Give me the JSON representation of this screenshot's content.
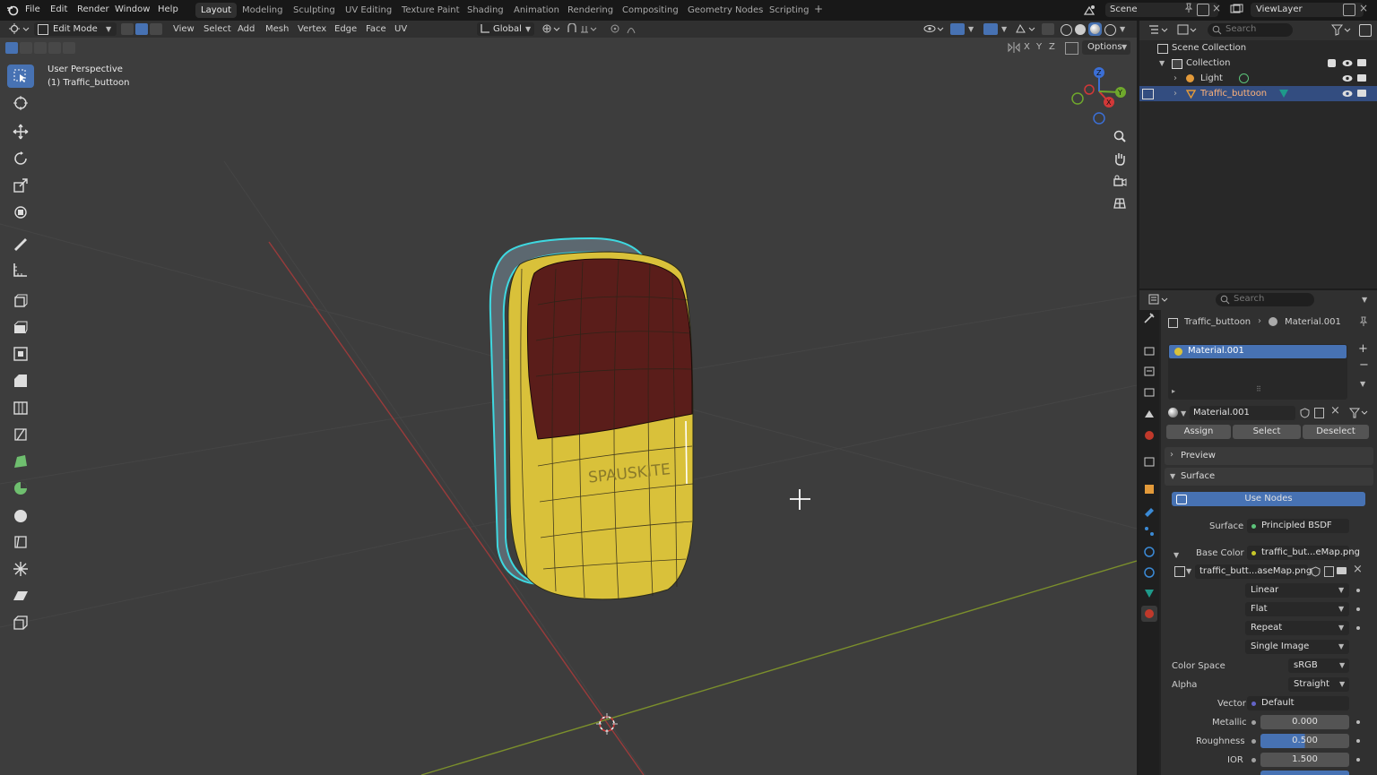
{
  "menubar": {
    "items": [
      "File",
      "Edit",
      "Render",
      "Window",
      "Help"
    ],
    "workspaces": [
      "Layout",
      "Modeling",
      "Sculpting",
      "UV Editing",
      "Texture Paint",
      "Shading",
      "Animation",
      "Rendering",
      "Compositing",
      "Geometry Nodes",
      "Scripting"
    ],
    "active_workspace": "Layout",
    "add_tab": "+",
    "scene": "Scene",
    "view_layer": "ViewLayer"
  },
  "viewport_header": {
    "mode": "Edit Mode",
    "menus": [
      "View",
      "Select",
      "Add",
      "Mesh",
      "Vertex",
      "Edge",
      "Face",
      "UV"
    ],
    "orientation": "Global",
    "axes": [
      "X",
      "Y",
      "Z"
    ],
    "options": "Options"
  },
  "viewport": {
    "perspective": "User Perspective",
    "object_label": "(1) Traffic_buttoon",
    "object_text": "SPAUSKITE"
  },
  "outliner": {
    "search_placeholder": "Search",
    "scene_collection": "Scene Collection",
    "collection": "Collection",
    "items": [
      "Light",
      "Traffic_buttoon"
    ]
  },
  "properties": {
    "search_placeholder": "Search",
    "breadcrumb_object": "Traffic_buttoon",
    "breadcrumb_material": "Material.001",
    "slot_name": "Material.001",
    "material_name": "Material.001",
    "assign": "Assign",
    "select": "Select",
    "deselect": "Deselect",
    "preview": "Preview",
    "surface_section": "Surface",
    "use_nodes": "Use Nodes",
    "surface_label": "Surface",
    "surface_value": "Principled BSDF",
    "base_color_label": "Base Color",
    "base_color_value": "traffic_but...eMap.png",
    "image_name": "traffic_butt...aseMap.png",
    "interpolation": "Linear",
    "projection": "Flat",
    "extension": "Repeat",
    "source": "Single Image",
    "color_space_label": "Color Space",
    "color_space": "sRGB",
    "alpha_label": "Alpha",
    "alpha": "Straight",
    "vector_label": "Vector",
    "vector": "Default",
    "metallic_label": "Metallic",
    "metallic": "0.000",
    "roughness_label": "Roughness",
    "roughness": "0.500",
    "ior_label": "IOR",
    "ior": "1.500"
  },
  "colors": {
    "accent": "#4772b3",
    "outline_selected": "#3ed8e0",
    "body_yellow": "#d9c13a",
    "cap_maroon": "#5a1d1a"
  }
}
